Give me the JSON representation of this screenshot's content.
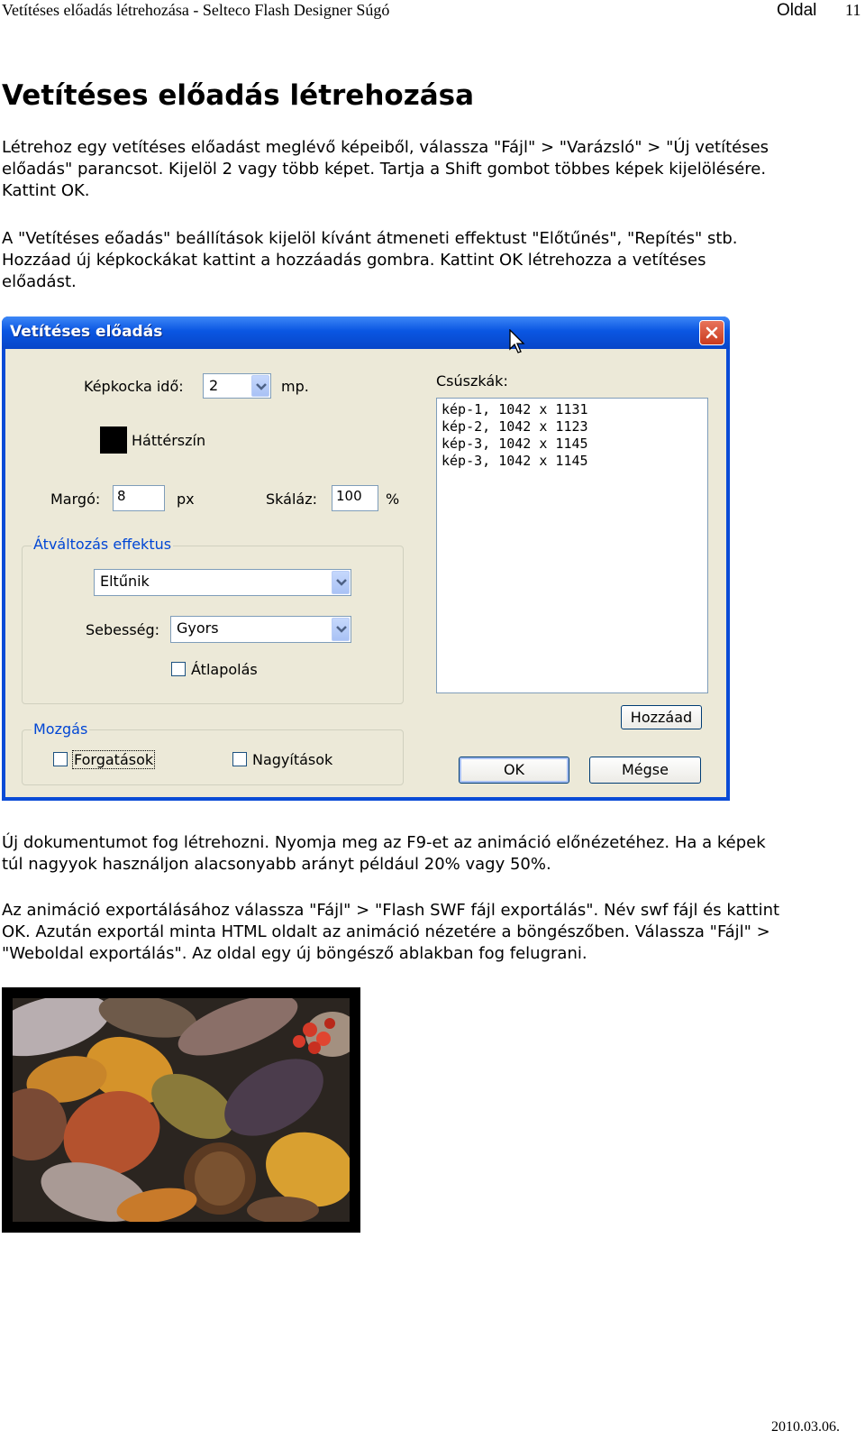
{
  "header": {
    "doc_title": "Vetítéses előadás létrehozása - Selteco Flash Designer Súgó",
    "page_label": "Oldal",
    "page_number": "11"
  },
  "heading": "Vetítéses előadás létrehozása",
  "paragraphs": {
    "p1_line1": "Létrehoz egy vetítéses előadást meglévő képeiből, válassza \"Fájl\" > \"Varázsló\" > \"Új vetítéses",
    "p1_line2": "előadás\" parancsot. Kijelöl 2 vagy több képet. Tartja a Shift gombot többes képek kijelölésére.",
    "p1_line3": "Kattint OK.",
    "p2_line1": "A \"Vetítéses eőadás\" beállítások kijelöl kívánt átmeneti effektust \"Előtűnés\", \"Repítés\" stb.",
    "p2_line2": "Hozzáad új képkockákat kattint a hozzáadás gombra. Kattint OK létrehozza a vetítéses",
    "p2_line3": "előadást.",
    "p3_line1": "Új dokumentumot fog létrehozni. Nyomja meg az F9-et az animáció előnézetéhez. Ha a képek",
    "p3_line2": "túl nagyyok használjon alacsonyabb arányt például 20% vagy 50%.",
    "p4_line1": "Az animáció exportálásához válassza \"Fájl\" > \"Flash SWF fájl exportálás\". Név swf fájl és kattint",
    "p4_line2": "OK. Azután exportál minta HTML oldalt az animáció nézetére a böngészőben. Válassza \"Fájl\" >",
    "p4_line3": "\"Weboldal exportálás\". Az oldal egy új böngésző ablakban fog felugrani."
  },
  "dialog": {
    "title": "Vetítéses előadás",
    "frame_time_label": "Képkocka idő:",
    "frame_time_value": "2",
    "frame_time_unit": "mp.",
    "bg_color_label": "Háttérszín",
    "margin_label": "Margó:",
    "margin_value": "8",
    "margin_unit": "px",
    "scale_label": "Skáláz:",
    "scale_value": "100",
    "scale_unit": "%",
    "slides_label": "Csúszkák:",
    "slides": [
      "kép-1, 1042 x 1131",
      "kép-2, 1042 x 1123",
      "kép-3, 1042 x 1145",
      "kép-3, 1042 x 1145"
    ],
    "transition_group": "Átváltozás effektus",
    "transition_value": "Eltűnik",
    "speed_label": "Sebesség:",
    "speed_value": "Gyors",
    "blend_label": "Átlapolás",
    "blend_checked": false,
    "motion_group": "Mozgás",
    "rotations_label": "Forgatások",
    "rotations_checked": false,
    "zooms_label": "Nagyítások",
    "zooms_checked": false,
    "add_button": "Hozzáad",
    "ok_button": "OK",
    "cancel_button": "Mégse"
  },
  "footer": {
    "date": "2010.03.06."
  },
  "colors": {
    "titlebar": "#0a56e2",
    "dialog_face": "#ece9d8",
    "group_label": "#0046d5",
    "close_button": "#d0492e"
  }
}
